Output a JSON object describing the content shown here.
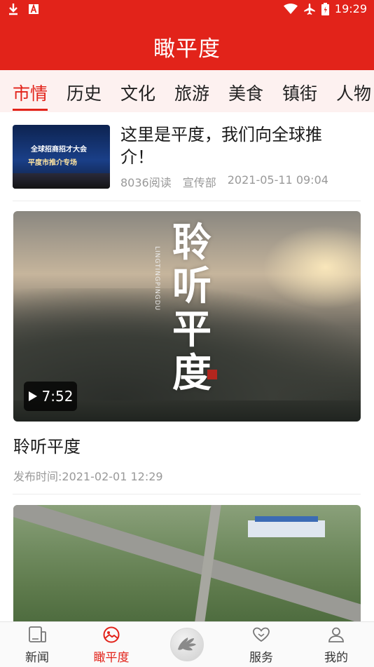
{
  "status_bar": {
    "time": "19:29",
    "left_icons": [
      "download-icon",
      "a-icon"
    ],
    "right_icons": [
      "wifi-icon",
      "airplane-icon",
      "battery-icon"
    ]
  },
  "app_bar": {
    "title": "瞰平度",
    "color": "#e2231a"
  },
  "tabs": [
    {
      "label": "市情",
      "active": true
    },
    {
      "label": "历史",
      "active": false
    },
    {
      "label": "文化",
      "active": false
    },
    {
      "label": "旅游",
      "active": false
    },
    {
      "label": "美食",
      "active": false
    },
    {
      "label": "镇街",
      "active": false
    },
    {
      "label": "人物",
      "active": false
    }
  ],
  "feed": {
    "article": {
      "title": "这里是平度，我们向全球推介！",
      "reads": "8036阅读",
      "source": "宣传部",
      "date": "2021-05-11 09:04",
      "thumb_text_1": "全球招商招才大会",
      "thumb_text_2": "平度市推介专场"
    },
    "video": {
      "calligraphy": "聆听平度",
      "pinyin": "LINGTINGPINGDU",
      "duration": "7:52",
      "title": "聆听平度",
      "publish_time": "发布时间:2021-02-01 12:29"
    }
  },
  "bottom_nav": [
    {
      "label": "新闻",
      "icon": "news-tablet-icon",
      "active": false
    },
    {
      "label": "瞰平度",
      "icon": "landscape-circle-icon",
      "active": true
    },
    {
      "label": "",
      "icon": "center-hand-logo-icon",
      "active": false
    },
    {
      "label": "服务",
      "icon": "heart-icon",
      "active": false
    },
    {
      "label": "我的",
      "icon": "user-icon",
      "active": false
    }
  ]
}
